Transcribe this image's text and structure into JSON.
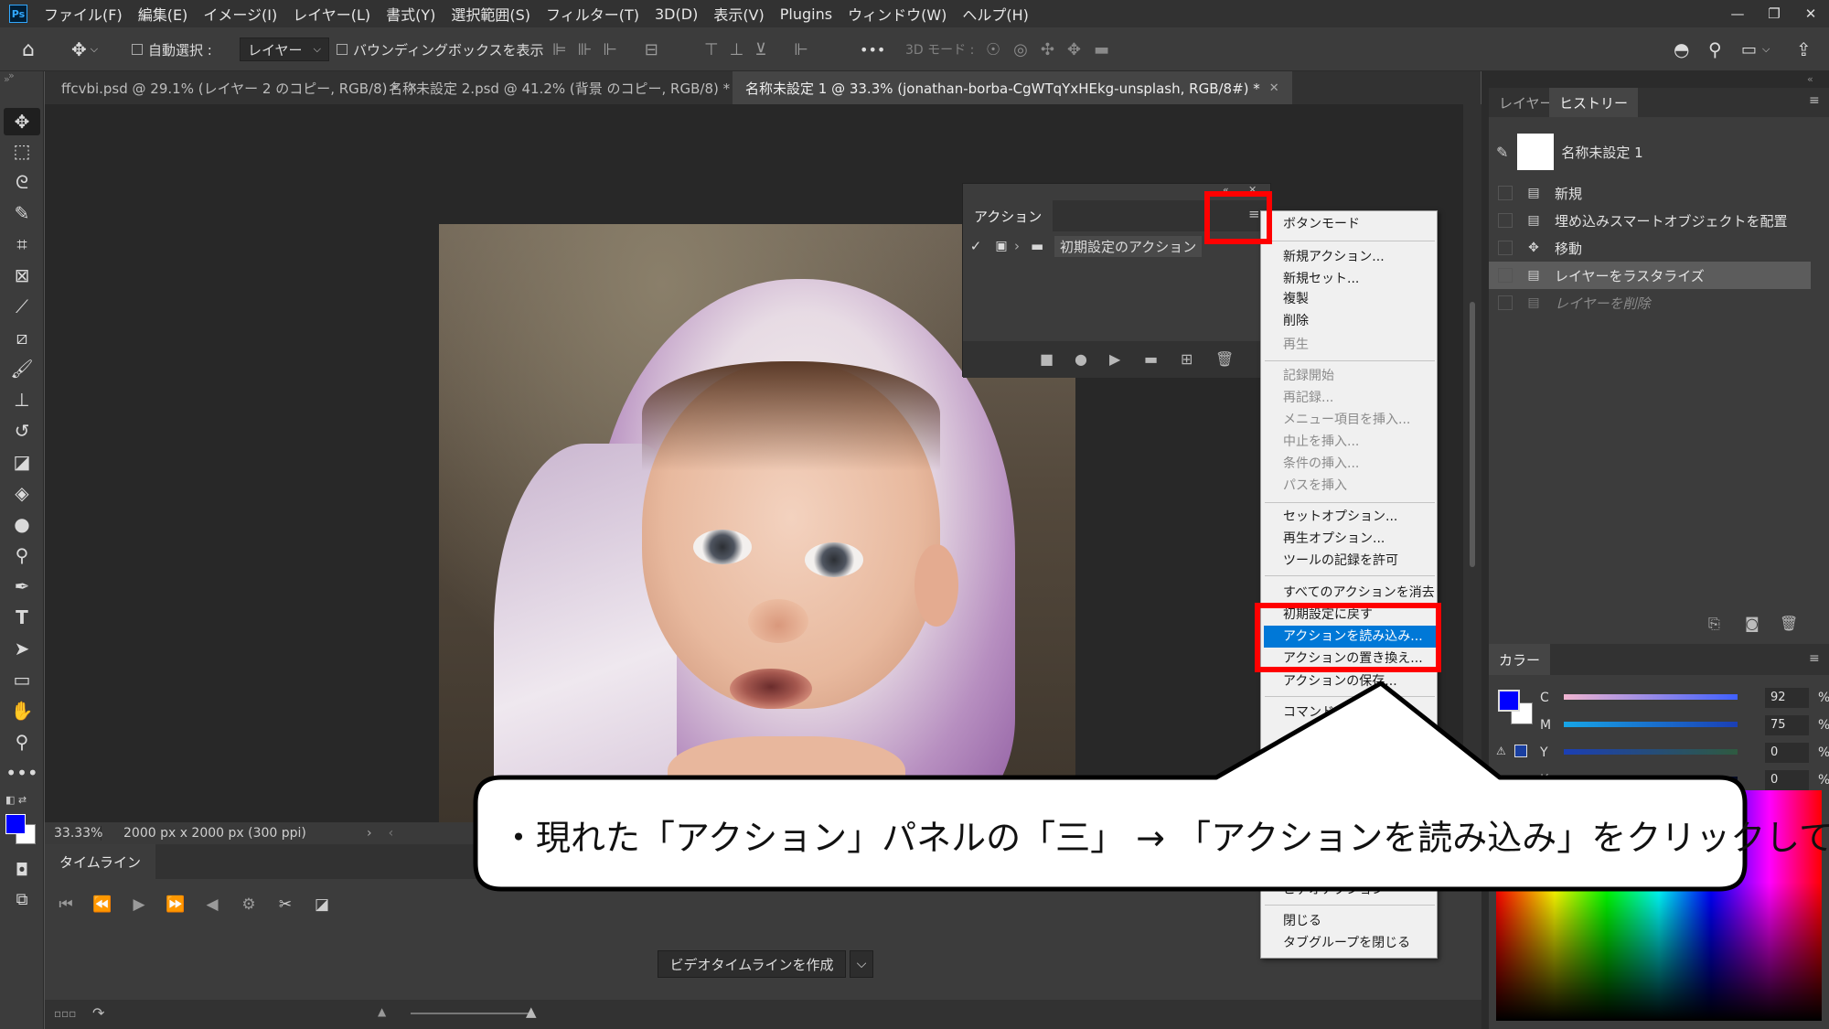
{
  "app": {
    "menu": [
      "ファイル(F)",
      "編集(E)",
      "イメージ(I)",
      "レイヤー(L)",
      "書式(Y)",
      "選択範囲(S)",
      "フィルター(T)",
      "3D(D)",
      "表示(V)",
      "Plugins",
      "ウィンドウ(W)",
      "ヘルプ(H)"
    ],
    "logo": "Ps"
  },
  "options": {
    "auto_select": "自動選択 :",
    "layer_dropdown": "レイヤー",
    "bounding_box": "バウンディングボックスを表示",
    "more": "•••",
    "mode_3d": "3D モード :"
  },
  "tabs": [
    "ffcvbi.psd @ 29.1% (レイヤー 2 のコピー, RGB/8) *",
    "名称未設定 2.psd @ 41.2% (背景 のコピー, RGB/8) *",
    "名称未設定 1 @ 33.3% (jonathan-borba-CgWTqYxHEkg-unsplash, RGB/8#) *"
  ],
  "status": {
    "zoom": "33.33%",
    "doc_size": "2000 px x 2000 px (300 ppi)"
  },
  "timeline": {
    "tab": "タイムライン",
    "create_button": "ビデオタイムラインを作成"
  },
  "history": {
    "tabs": [
      "レイヤー",
      "ヒストリー"
    ],
    "snapshot": "名称未設定 1",
    "items": [
      "新規",
      "埋め込みスマートオブジェクトを配置",
      "移動",
      "レイヤーをラスタライズ",
      "レイヤーを削除"
    ]
  },
  "color": {
    "tab": "カラー",
    "channels": [
      {
        "label": "C",
        "value": "92"
      },
      {
        "label": "M",
        "value": "75"
      },
      {
        "label": "Y",
        "value": "0"
      },
      {
        "label": "K",
        "value": "0"
      }
    ],
    "unit": "%",
    "foreground": "#0000ff",
    "background": "#ffffff"
  },
  "actions": {
    "title": "アクション",
    "set_name": "初期設定のアクション"
  },
  "flyout": {
    "items": [
      "ボタンモード",
      "新規アクション...",
      "新規セット...",
      "複製",
      "削除",
      "再生",
      "記録開始",
      "再記録...",
      "メニュー項目を挿入...",
      "中止を挿入...",
      "条件の挿入...",
      "パスを挿入",
      "セットオプション...",
      "再生オプション...",
      "ツールの記録を許可",
      "すべてのアクションを消去",
      "初期設定に戻す",
      "アクションを読み込み...",
      "アクションの置き換え...",
      "アクションの保存...",
      "コマンド",
      "ビデオアクション",
      "閉じる",
      "タブグループを閉じる"
    ]
  },
  "annotation": {
    "text": "・現れた「アクション」パネルの「三」 → 「アクションを読み込み」をクリックしてください",
    "highlight_color": "#ff0000"
  }
}
